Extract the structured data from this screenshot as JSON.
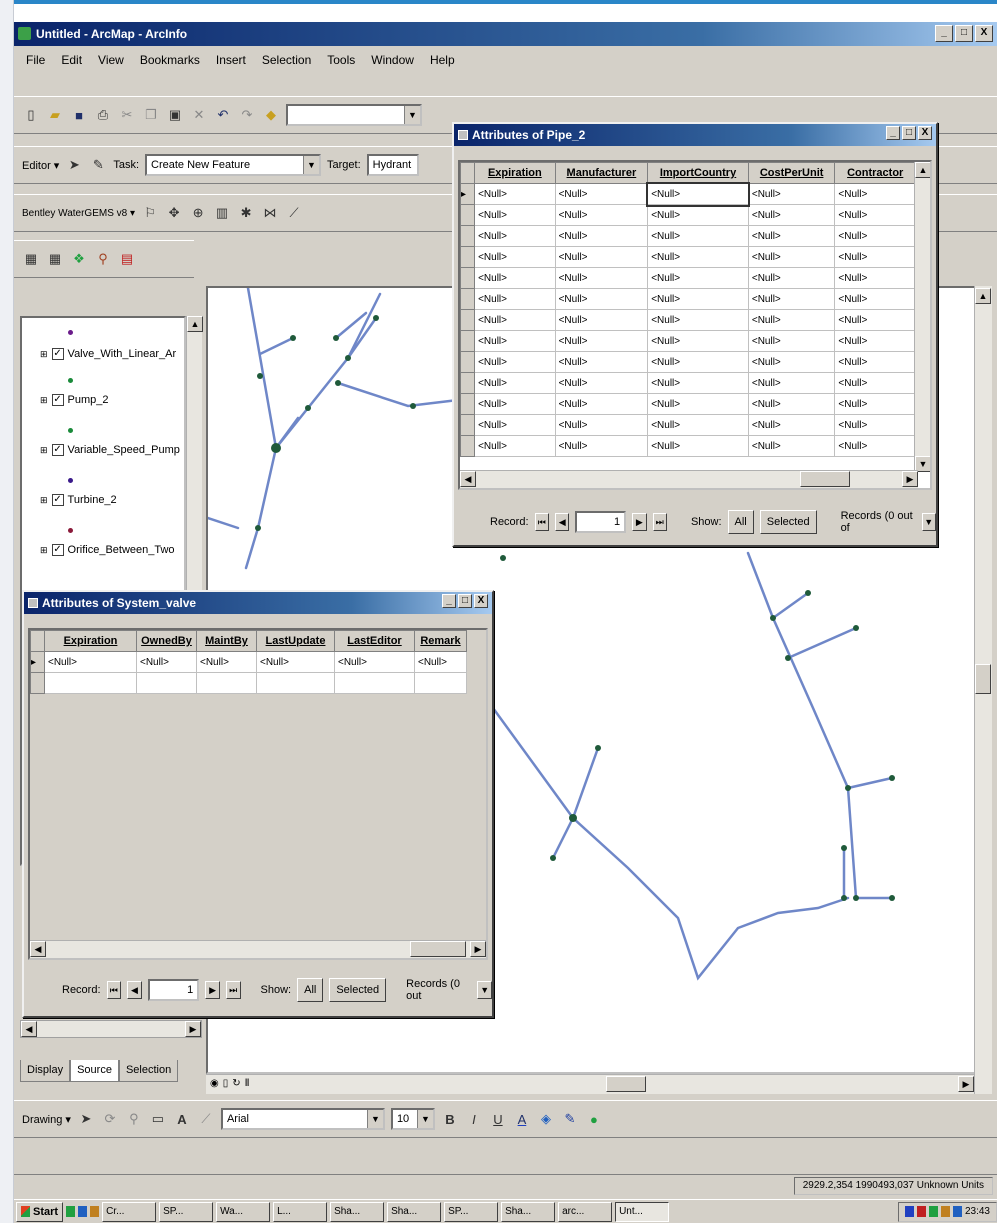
{
  "app": {
    "title": "Untitled - ArcMap - ArcInfo",
    "window_buttons": [
      "_",
      "□",
      "X"
    ],
    "menus": [
      "File",
      "Edit",
      "View",
      "Bookmarks",
      "Insert",
      "Selection",
      "Tools",
      "Window",
      "Help"
    ]
  },
  "editor_toolbar": {
    "editor_label": "Editor ▾",
    "task_label": "Task:",
    "task_value": "Create New Feature",
    "target_label": "Target:",
    "target_value": "Hydrant"
  },
  "bentley_toolbar": {
    "label": "Bentley WaterGEMS v8 ▾"
  },
  "toc": {
    "layers": [
      {
        "name": "Valve_With_Linear_Ar",
        "checked": true,
        "symbol_color": "#6a1b8a"
      },
      {
        "name": "Pump_2",
        "checked": true,
        "symbol_color": "#1a8a3a"
      },
      {
        "name": "Variable_Speed_Pump",
        "checked": true,
        "symbol_color": "#1a8a3a"
      },
      {
        "name": "Turbine_2",
        "checked": true,
        "symbol_color": "#3a1a8a"
      },
      {
        "name": "Orifice_Between_Two",
        "checked": true,
        "symbol_color": "#8a1a3a"
      }
    ],
    "tabs": [
      "Display",
      "Source",
      "Selection"
    ]
  },
  "pipe_window": {
    "title": "Attributes of Pipe_2",
    "columns": [
      "Expiration",
      "Manufacturer",
      "ImportCountry",
      "CostPerUnit",
      "Contractor"
    ],
    "rows": [
      [
        "<Null>",
        "<Null>",
        "<Null>",
        "<Null>",
        "<Null>"
      ],
      [
        "<Null>",
        "<Null>",
        "<Null>",
        "<Null>",
        "<Null>"
      ],
      [
        "<Null>",
        "<Null>",
        "<Null>",
        "<Null>",
        "<Null>"
      ],
      [
        "<Null>",
        "<Null>",
        "<Null>",
        "<Null>",
        "<Null>"
      ],
      [
        "<Null>",
        "<Null>",
        "<Null>",
        "<Null>",
        "<Null>"
      ],
      [
        "<Null>",
        "<Null>",
        "<Null>",
        "<Null>",
        "<Null>"
      ],
      [
        "<Null>",
        "<Null>",
        "<Null>",
        "<Null>",
        "<Null>"
      ],
      [
        "<Null>",
        "<Null>",
        "<Null>",
        "<Null>",
        "<Null>"
      ],
      [
        "<Null>",
        "<Null>",
        "<Null>",
        "<Null>",
        "<Null>"
      ],
      [
        "<Null>",
        "<Null>",
        "<Null>",
        "<Null>",
        "<Null>"
      ],
      [
        "<Null>",
        "<Null>",
        "<Null>",
        "<Null>",
        "<Null>"
      ],
      [
        "<Null>",
        "<Null>",
        "<Null>",
        "<Null>",
        "<Null>"
      ],
      [
        "<Null>",
        "<Null>",
        "<Null>",
        "<Null>",
        "<Null>"
      ]
    ],
    "record_label": "Record:",
    "record_value": "1",
    "show_label": "Show:",
    "all_label": "All",
    "selected_label": "Selected",
    "records_text": "Records (0 out of"
  },
  "valve_window": {
    "title": "Attributes of System_valve",
    "columns": [
      "Expiration",
      "OwnedBy",
      "MaintBy",
      "LastUpdate",
      "LastEditor",
      "Remark"
    ],
    "rows": [
      [
        "<Null>",
        "<Null>",
        "<Null>",
        "<Null>",
        "<Null>",
        "<Null>"
      ]
    ],
    "record_label": "Record:",
    "record_value": "1",
    "show_label": "Show:",
    "all_label": "All",
    "selected_label": "Selected",
    "records_text": "Records (0 out"
  },
  "drawing_toolbar": {
    "drawing_label": "Drawing ▾",
    "font_value": "Arial",
    "size_value": "10",
    "bold": "B",
    "italic": "I",
    "underline": "U"
  },
  "status": {
    "coords": "2929.2,354  1990493,037 Unknown Units"
  },
  "taskbar": {
    "start_label": "Start",
    "tasks": [
      "Cr...",
      "SP...",
      "Wa...",
      "L...",
      "Sha...",
      "Sha...",
      "SP...",
      "Sha...",
      "arc...",
      "Unt..."
    ],
    "active_index": 9,
    "clock": "23:43"
  }
}
